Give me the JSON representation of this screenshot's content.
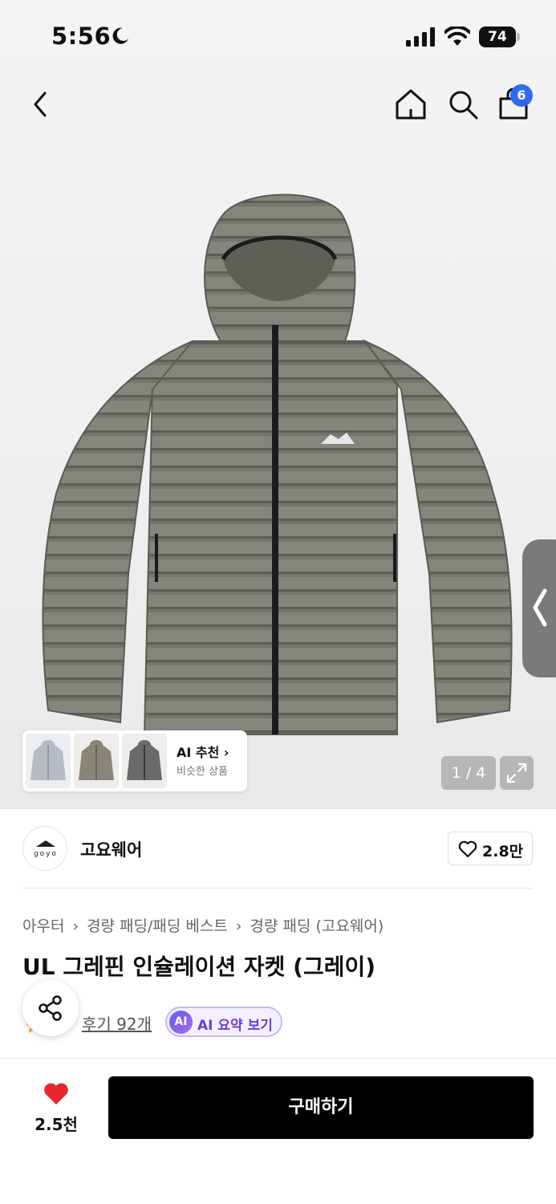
{
  "status_bar": {
    "time": "5:56",
    "battery": "74"
  },
  "nav": {
    "cart_count": "6"
  },
  "hero": {
    "ai_recommend": {
      "title": "AI 추천 ›",
      "subtitle": "비슷한 상품"
    },
    "pager": "1 / 4"
  },
  "brand": {
    "name": "고요웨어",
    "logo_text": "goyo",
    "likes": "2.8만"
  },
  "product": {
    "breadcrumbs": [
      "아우터",
      "경량 패딩/패딩 베스트",
      "경량 패딩 (고요웨어)"
    ],
    "title": "UL 그레핀 인슐레이션 자켓 (그레이)",
    "reviews_link": "후기 92개",
    "ai_summary_badge": "AI",
    "ai_summary_label": "AI 요약 보기"
  },
  "bottom_bar": {
    "wish_count": "2.5천",
    "buy_label": "구매하기"
  },
  "colors": {
    "accent_blue": "#2f6bf2",
    "wish_red": "#e8262b",
    "ai_purple": "#6a3fd8"
  }
}
